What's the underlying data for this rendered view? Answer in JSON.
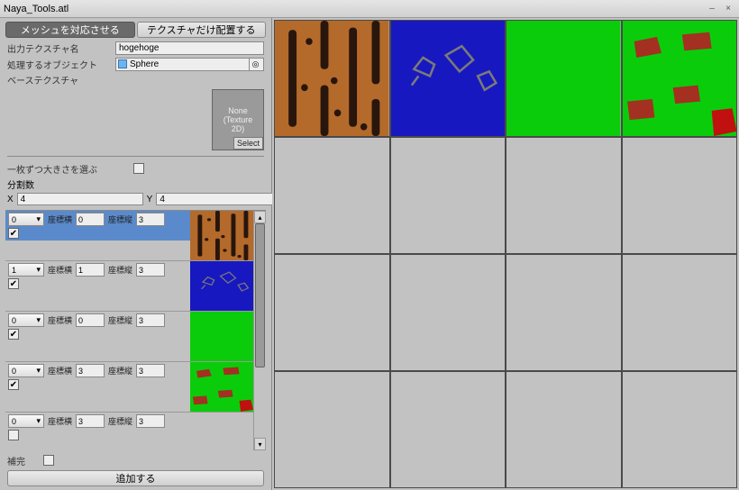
{
  "window": {
    "title": "Naya_Tools.atl"
  },
  "tabs": {
    "mesh": "メッシュを対応させる",
    "texture": "テクスチャだけ配置する",
    "active": "mesh"
  },
  "fields": {
    "output_texture_name": {
      "label": "出力テクスチャ名",
      "value": "hogehoge"
    },
    "target_object": {
      "label": "処理するオブジェクト",
      "value": "Sphere"
    },
    "base_texture": {
      "label": "ベーステクスチャ",
      "none": "None",
      "type": "(Texture\n2D)",
      "select": "Select"
    }
  },
  "options": {
    "individual_size": {
      "label": "一枚ずつ大きさを選ぶ",
      "checked": false
    },
    "divisions": {
      "label": "分割数",
      "x_label": "X",
      "y_label": "Y",
      "x": "4",
      "y": "4"
    }
  },
  "item_labels": {
    "coord_x": "座標横",
    "coord_y": "座標縦"
  },
  "items": [
    {
      "dd": "0",
      "x": "0",
      "y": "3",
      "checked": true,
      "selected": true,
      "tex": "brown"
    },
    {
      "dd": "1",
      "x": "1",
      "y": "3",
      "checked": true,
      "selected": false,
      "tex": "blue"
    },
    {
      "dd": "0",
      "x": "0",
      "y": "3",
      "checked": true,
      "selected": false,
      "tex": "green"
    },
    {
      "dd": "0",
      "x": "3",
      "y": "3",
      "checked": true,
      "selected": false,
      "tex": "greenred"
    },
    {
      "dd": "0",
      "x": "3",
      "y": "3",
      "checked": false,
      "selected": false,
      "tex": "none"
    }
  ],
  "bottom": {
    "complete_label": "補完",
    "complete_checked": false,
    "add_button": "追加する"
  },
  "grid": {
    "cols": 4,
    "rows": 4,
    "cells": [
      "brown",
      "blue",
      "green",
      "greenred",
      "",
      "",
      "",
      "",
      "",
      "",
      "",
      "",
      "",
      "",
      "",
      ""
    ]
  }
}
